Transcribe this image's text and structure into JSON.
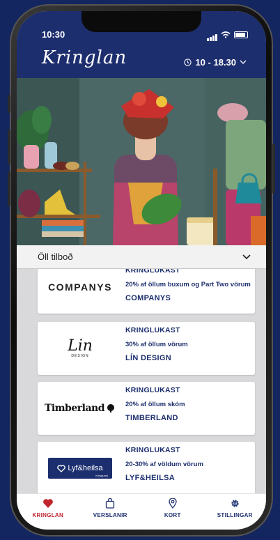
{
  "status": {
    "time": "10:30"
  },
  "header": {
    "logo": "Kringlan",
    "hours": "10 - 18.30"
  },
  "filter": {
    "label": "Öll tilboð"
  },
  "offers": [
    {
      "logo": "COMPANYS",
      "tag": "KRINGLUKAST",
      "desc": "20% af öllum buxum og Part Two vörum",
      "name": "COMPANYS"
    },
    {
      "logo": "Lin",
      "logo_sub": "DESIGN",
      "tag": "KRINGLUKAST",
      "desc": "30% af öllum vörum",
      "name": "LÍN DESIGN"
    },
    {
      "logo": "Timberland",
      "tag": "KRINGLUKAST",
      "desc": "20% af öllum skóm",
      "name": "TIMBERLAND"
    },
    {
      "logo": "Lyf&heilsa",
      "logo_sub": "Kringlunni",
      "tag": "KRINGLUKAST",
      "desc": "20-30% af völdum vörum",
      "name": "LYF&HEILSA"
    }
  ],
  "tabs": [
    {
      "label": "KRINGLAN",
      "icon": "heart-icon",
      "active": true
    },
    {
      "label": "VERSLANIR",
      "icon": "bag-icon",
      "active": false
    },
    {
      "label": "KORT",
      "icon": "map-pin-icon",
      "active": false
    },
    {
      "label": "STILLINGAR",
      "icon": "gear-icon",
      "active": false
    }
  ],
  "colors": {
    "brand_navy": "#1c2e6e",
    "accent_red": "#c0252f",
    "background": "#142660"
  }
}
